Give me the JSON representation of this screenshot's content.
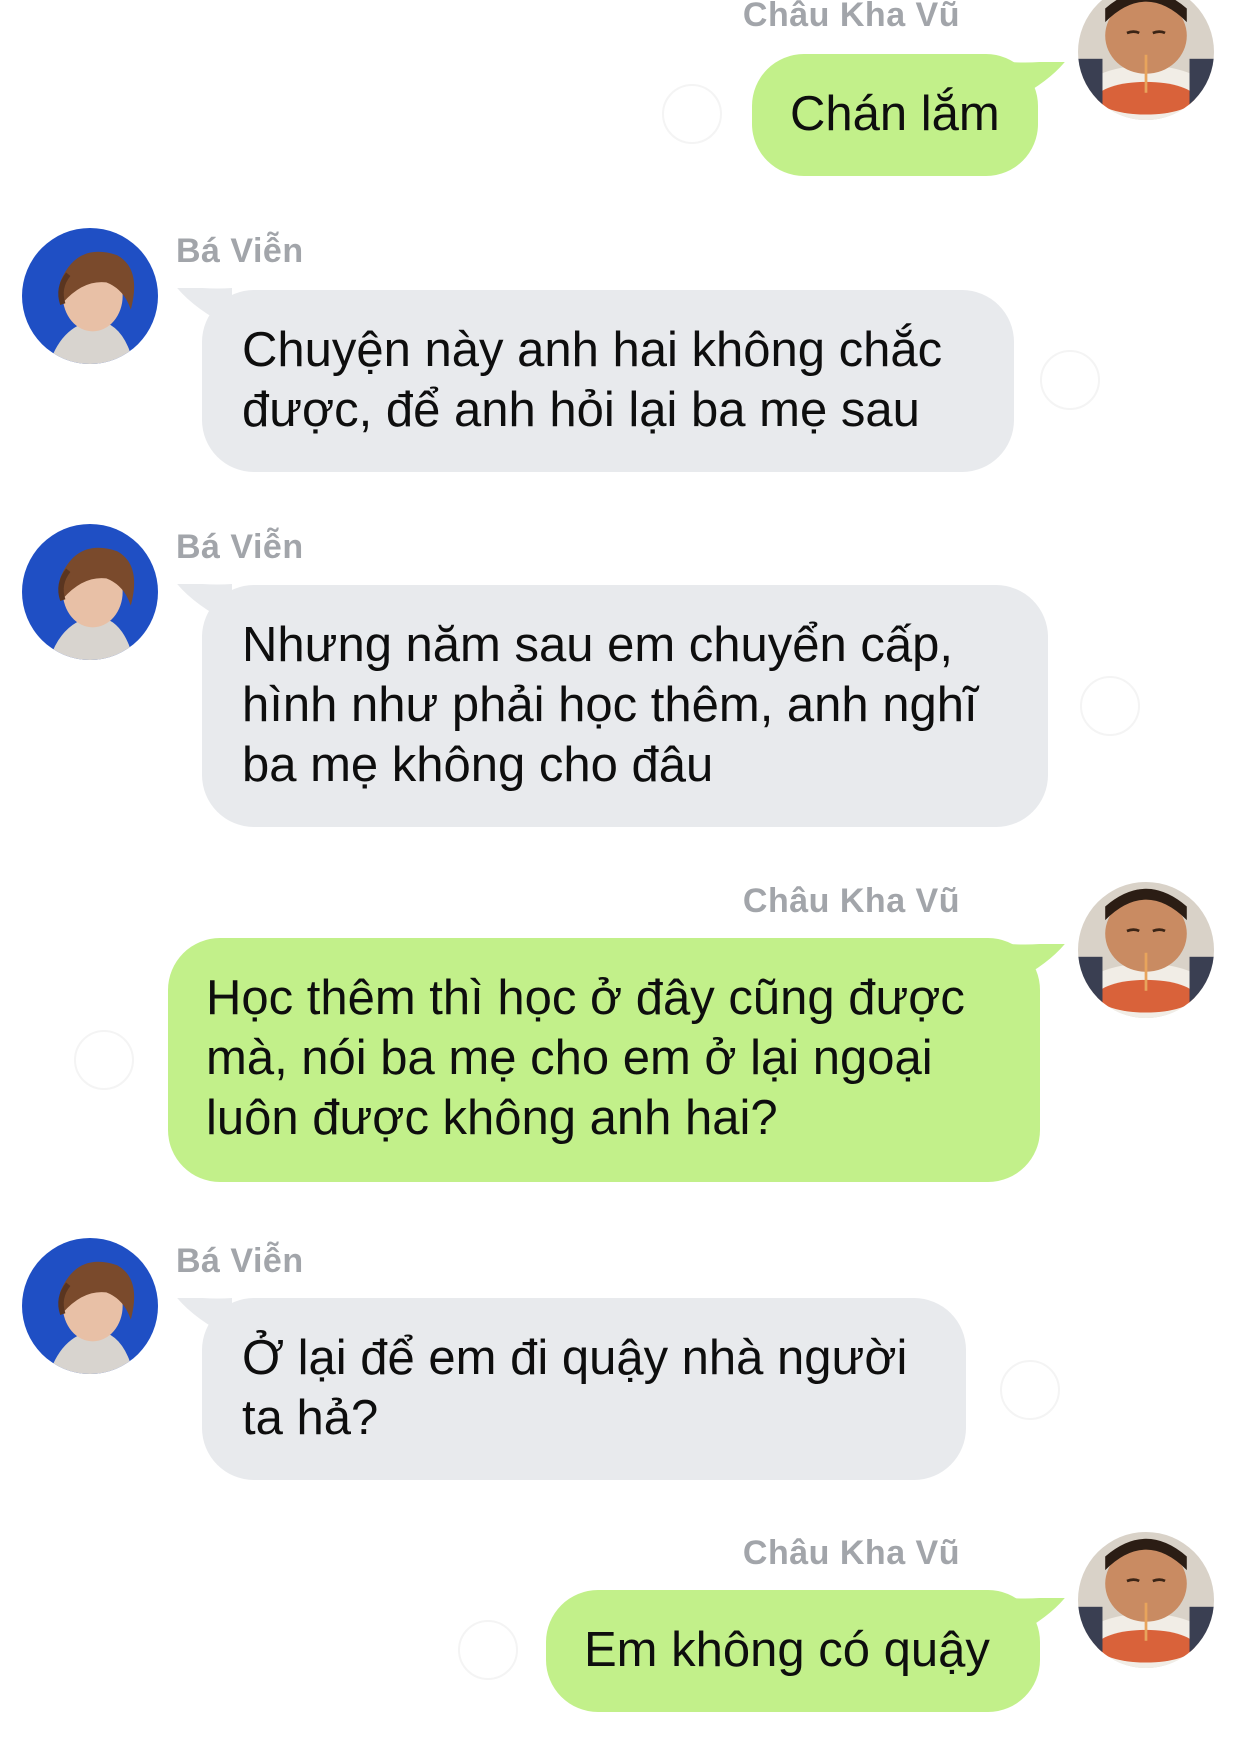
{
  "conversation": {
    "messages": [
      {
        "sender": "Châu Kha Vũ",
        "direction": "outgoing",
        "lines": [
          "Chán lắm"
        ]
      },
      {
        "sender": "Bá Viễn",
        "direction": "incoming",
        "lines": [
          "Chuyện này anh hai không chắc",
          "được, để anh hỏi lại ba mẹ sau"
        ]
      },
      {
        "sender": "Bá Viễn",
        "direction": "incoming",
        "lines": [
          "Nhưng năm sau em chuyển cấp,",
          "hình như phải học thêm, anh nghĩ",
          "ba mẹ không cho đâu"
        ]
      },
      {
        "sender": "Châu Kha Vũ",
        "direction": "outgoing",
        "lines": [
          "Học thêm thì học ở đây cũng được",
          "mà, nói ba mẹ cho em ở lại ngoại",
          "luôn được không anh hai?"
        ]
      },
      {
        "sender": "Bá Viễn",
        "direction": "incoming",
        "lines": [
          "Ở lại để em đi quậy nhà người",
          "ta hả?"
        ]
      },
      {
        "sender": "Châu Kha Vũ",
        "direction": "outgoing",
        "lines": [
          "Em không có quậy"
        ]
      }
    ]
  },
  "colors": {
    "incoming_bubble": "#e8eaed",
    "outgoing_bubble": "#c2f08a",
    "name_text": "#a2a5aa",
    "message_text": "#0e0e0e"
  },
  "icons": {
    "incoming_avatar": "avatar-photo-blue-background",
    "outgoing_avatar": "avatar-photo-child-eating-noodles"
  }
}
